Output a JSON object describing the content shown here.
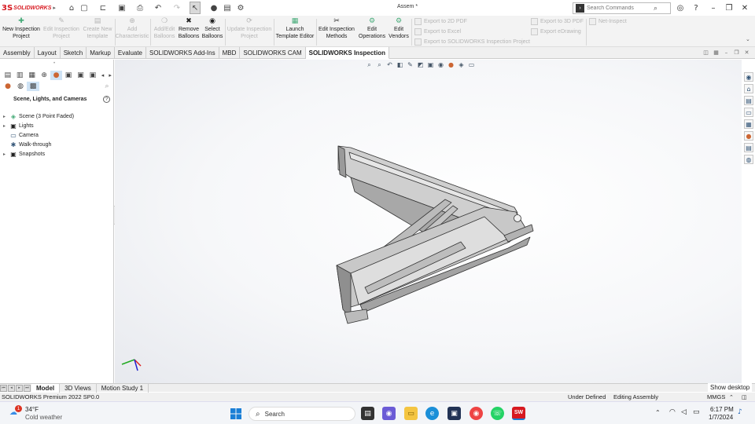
{
  "app": {
    "logo_mark": "3S",
    "logo_text": "SOLIDWORKS",
    "doc_title": "Assem *"
  },
  "search": {
    "placeholder": "Search Commands"
  },
  "ribbon": {
    "new_inspection": "New Inspection\nProject",
    "edit_inspection": "Edit Inspection\nProject",
    "create_template": "Create New\ntemplate",
    "add_characteristic": "Add\nCharacteristic",
    "add_edit_balloons": "Add/Edit\nBalloons",
    "remove_balloons": "Remove\nBalloons",
    "select_balloons": "Select\nBalloons",
    "update_inspection": "Update Inspection\nProject",
    "launch_template_editor": "Launch\nTemplate Editor",
    "edit_inspection_methods": "Edit Inspection\nMethods",
    "edit_operations": "Edit\nOperations",
    "edit_vendors": "Edit\nVendors",
    "export_2d_pdf": "Export to 2D PDF",
    "export_excel": "Export to Excel",
    "export_sw_project": "Export to SOLIDWORKS Inspection Project",
    "export_3d_pdf": "Export to 3D PDF",
    "export_edrawing": "Export eDrawing",
    "net_inspect": "Net-Inspect"
  },
  "command_tabs": [
    "Assembly",
    "Layout",
    "Sketch",
    "Markup",
    "Evaluate",
    "SOLIDWORKS Add-Ins",
    "MBD",
    "SOLIDWORKS CAM",
    "SOLIDWORKS Inspection"
  ],
  "panel": {
    "title": "Scene, Lights, and Cameras",
    "tree": [
      {
        "label": "Scene (3 Point Faded)",
        "expand": "▸"
      },
      {
        "label": "Lights",
        "expand": "▸"
      },
      {
        "label": "Camera",
        "expand": ""
      },
      {
        "label": "Walk-through",
        "expand": ""
      },
      {
        "label": "Snapshots",
        "expand": "▸"
      }
    ]
  },
  "bottom_tabs": [
    "Model",
    "3D Views",
    "Motion Study 1"
  ],
  "show_desktop": "Show desktop",
  "status": {
    "product": "SOLIDWORKS Premium 2022 SP0.0",
    "under_defined": "Under Defined",
    "editing": "Editing Assembly",
    "units": "MMGS"
  },
  "taskbar": {
    "temperature": "34°F",
    "weather": "Cold weather",
    "weather_badge": "1",
    "search_label": "Search",
    "time": "6:17 PM",
    "date": "1/7/2024",
    "sw_app_label": "SW"
  },
  "colors": {
    "accent": "#d71920",
    "ribbon_bg": "#f3f3f3",
    "tab_active": "#ffffff",
    "model_gray": "#b9b9b9"
  }
}
